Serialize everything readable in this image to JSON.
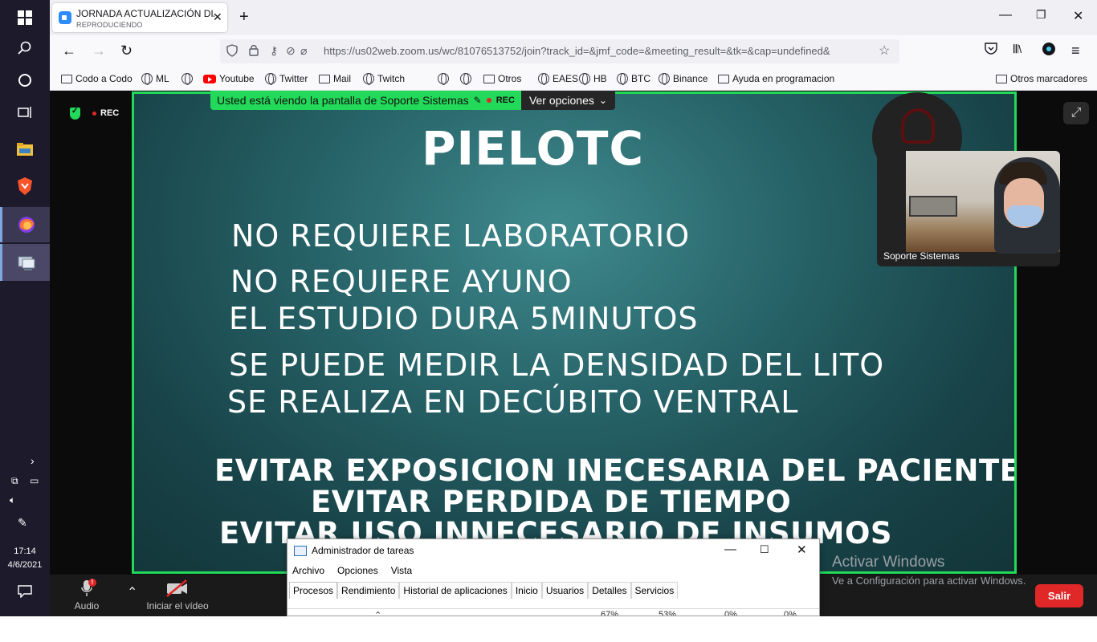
{
  "taskbar": {
    "clock_time": "17:14",
    "clock_date": "4/6/2021"
  },
  "browser": {
    "tab_title": "JORNADA ACTUALIZACIÓN DIA",
    "tab_subtitle": "REPRODUCIENDO",
    "url": "https://us02web.zoom.us/wc/81076513752/join?track_id=&jmf_code=&meeting_result=&tk=&cap=undefined&",
    "bookmarks": [
      "Codo a Codo",
      "ML",
      "",
      "Youtube",
      "Twitter",
      "Mail",
      "Twitch",
      "",
      "",
      "Otros",
      "EAES",
      "HB",
      "BTC",
      "Binance",
      "Ayuda en programacion"
    ],
    "other_bookmarks": "Otros marcadores"
  },
  "zoom": {
    "rec_label": "REC",
    "banner_text": "Usted está viendo la pantalla de Soporte Sistemas",
    "banner_rec": "REC",
    "view_options": "Ver opciones",
    "participant_name": "Soporte Sistemas",
    "toolbar": {
      "audio": "Audio",
      "audio_badge": "!",
      "video": "Iniciar el vídeo",
      "leave": "Salir"
    },
    "accent_color": "#23d959"
  },
  "slide": {
    "title": "PIELOTC",
    "lines": [
      "NO REQUIERE LABORATORIO",
      "NO REQUIERE AYUNO",
      "EL ESTUDIO DURA 5MINUTOS",
      "SE PUEDE MEDIR LA DENSIDAD DEL LITO",
      "SE REALIZA EN DECÚBITO VENTRAL"
    ],
    "bold_lines": [
      "EVITAR EXPOSICION INECESARIA DEL PACIENTE",
      "EVITAR PERDIDA DE TIEMPO",
      "EVITAR USO INNECESARIO DE INSUMOS"
    ]
  },
  "activation": {
    "title": "Activar Windows",
    "subtitle": "Ve a Configuración para activar Windows."
  },
  "task_manager": {
    "title": "Administrador de tareas",
    "menu": [
      "Archivo",
      "Opciones",
      "Vista"
    ],
    "tabs": [
      "Procesos",
      "Rendimiento",
      "Historial de aplicaciones",
      "Inicio",
      "Usuarios",
      "Detalles",
      "Servicios"
    ],
    "column_values": [
      "67%",
      "53%",
      "0%",
      "0%"
    ]
  }
}
